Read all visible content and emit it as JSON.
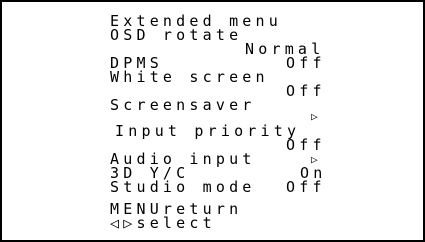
{
  "menu": {
    "title": "Extended menu",
    "items": [
      {
        "label": "OSD rotate",
        "value": "Normal"
      },
      {
        "label": "DPMS",
        "value": "Off"
      },
      {
        "label": "White screen",
        "value": "Off"
      },
      {
        "label": "Screensaver",
        "value": "▷"
      },
      {
        "label": "Input priority",
        "value": "Off"
      },
      {
        "label": "Audio input",
        "value": "▷"
      },
      {
        "label": "3D Y/C",
        "value": "On"
      },
      {
        "label": "Studio mode",
        "value": "Off"
      }
    ],
    "footer": {
      "return_label": "MENUreturn",
      "select_label": "◁▷select"
    }
  }
}
